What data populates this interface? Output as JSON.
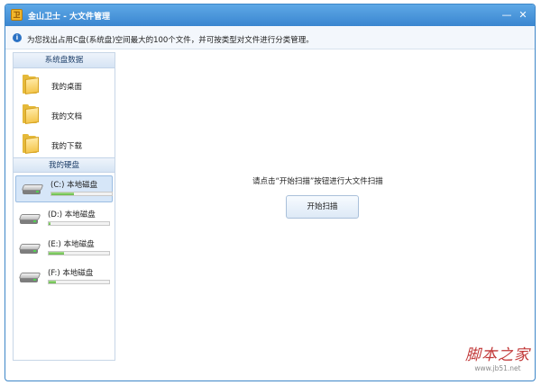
{
  "window": {
    "title": "金山卫士 - 大文件管理",
    "logo_glyph": "卫",
    "minimize_glyph": "—",
    "close_glyph": "✕"
  },
  "info": {
    "icon": "info-icon",
    "icon_glyph": "i",
    "text": "为您找出占用C盘(系统盘)空间最大的100个文件，并可按类型对文件进行分类管理。"
  },
  "sidebar": {
    "system_header": "系统盘数据",
    "folders": [
      {
        "label": "我的桌面",
        "icon": "folder-icon"
      },
      {
        "label": "我的文档",
        "icon": "folder-icon"
      },
      {
        "label": "我的下载",
        "icon": "folder-icon"
      }
    ],
    "disks_header": "我的硬盘",
    "disks": [
      {
        "label": "(C:) 本地磁盘",
        "usage": 0.38,
        "selected": true
      },
      {
        "label": "(D:) 本地磁盘",
        "usage": 0.03,
        "selected": false
      },
      {
        "label": "(E:) 本地磁盘",
        "usage": 0.25,
        "selected": false
      },
      {
        "label": "(F:) 本地磁盘",
        "usage": 0.12,
        "selected": false
      }
    ]
  },
  "main": {
    "hint": "请点击“开始扫描”按钮进行大文件扫描",
    "start_button": "开始扫描"
  },
  "watermark": {
    "main": "脚本之家",
    "url": "www.jb51.net"
  },
  "colors": {
    "titlebar": "#3a86d0",
    "accent": "#2b72c4",
    "usage_fill": "#62b845",
    "watermark": "#c23a3a"
  }
}
